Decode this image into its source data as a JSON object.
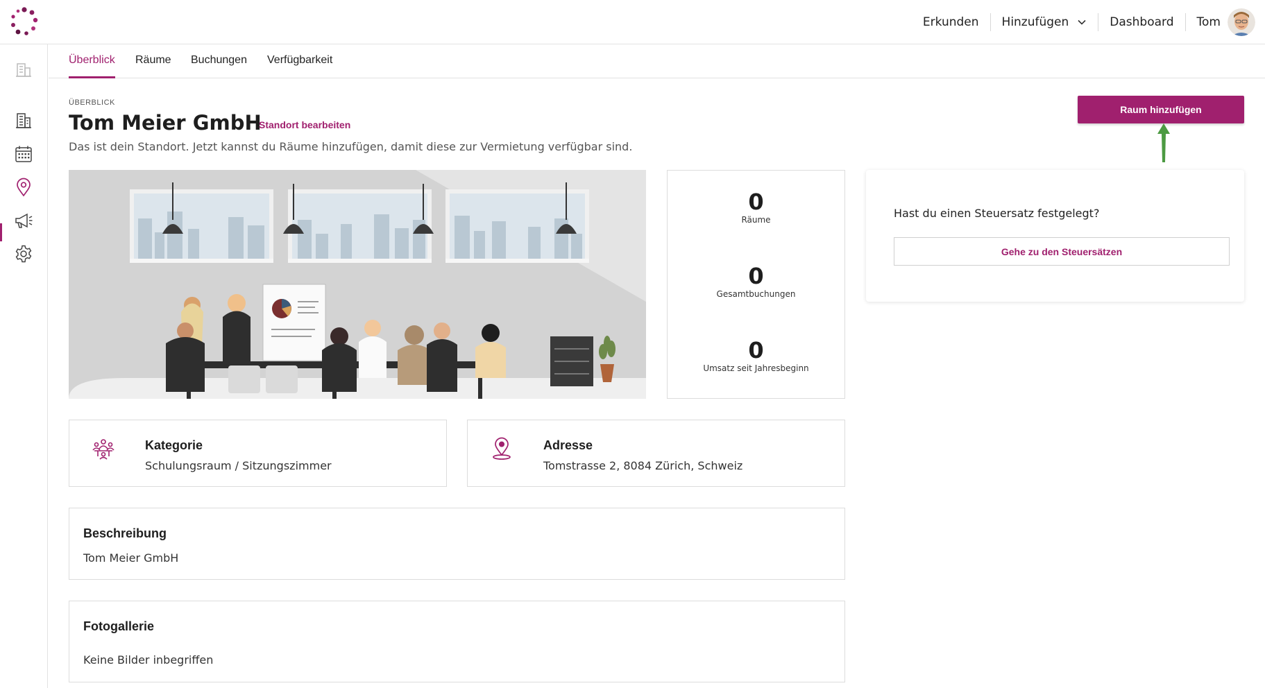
{
  "header": {
    "nav": [
      "Erkunden",
      "Hinzufügen",
      "Dashboard",
      "Tom"
    ]
  },
  "tabs": [
    "Überblick",
    "Räume",
    "Buchungen",
    "Verfügbarkeit"
  ],
  "page": {
    "eyebrow": "ÜBERBLICK",
    "title": "Tom Meier GmbH",
    "edit_link": "Standort bearbeiten",
    "subtitle": "Das ist dein Standort. Jetzt kannst du Räume hinzufügen, damit diese zur Vermietung verfügbar sind.",
    "add_room_button": "Raum hinzufügen"
  },
  "stats": [
    {
      "value": "0",
      "label": "Räume"
    },
    {
      "value": "0",
      "label": "Gesamtbuchungen"
    },
    {
      "value": "0",
      "label": "Umsatz seit Jahresbeginn"
    }
  ],
  "tax": {
    "question": "Hast du einen Steuersatz festgelegt?",
    "button": "Gehe zu den Steuersätzen"
  },
  "category": {
    "heading": "Kategorie",
    "value": "Schulungsraum / Sitzungszimmer"
  },
  "address": {
    "heading": "Adresse",
    "value": "Tomstrasse 2, 8084 Zürich, Schweiz"
  },
  "description": {
    "heading": "Beschreibung",
    "value": "Tom Meier GmbH"
  },
  "gallery": {
    "heading": "Fotogallerie",
    "value": "Keine Bilder inbegriffen"
  },
  "colors": {
    "accent": "#a0206e",
    "arrow": "#4c9a42"
  },
  "icons": {
    "logo": "dotted-circle-logo",
    "sidebar": [
      "building-icon",
      "building-icon",
      "calendar-icon",
      "location-pin-icon",
      "megaphone-icon",
      "gear-icon"
    ],
    "category": "meeting-people-icon",
    "address": "location-pin-icon"
  }
}
